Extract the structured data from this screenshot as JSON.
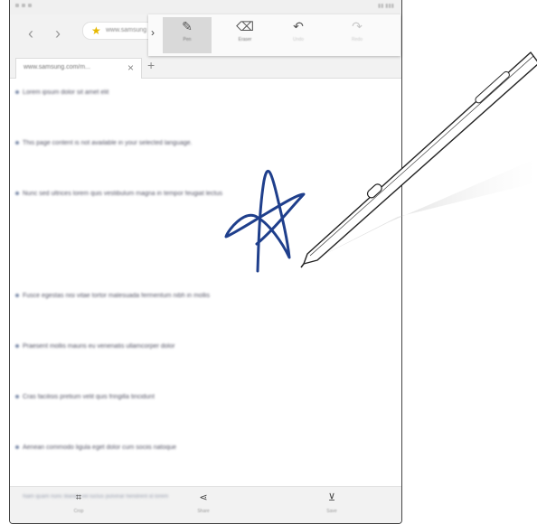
{
  "browser": {
    "url": "www.samsung",
    "tab_title": "www.samsung.com/m...",
    "tab_close": "×",
    "new_tab": "+",
    "back": "‹",
    "forward": "›"
  },
  "toolbar": {
    "expand": "›",
    "tools": [
      {
        "label": "Pen",
        "icon": "pen-icon"
      },
      {
        "label": "Eraser",
        "icon": "eraser-icon"
      },
      {
        "label": "Undo",
        "icon": "undo-icon"
      },
      {
        "label": "Redo",
        "icon": "redo-icon"
      }
    ]
  },
  "content_lines": [
    "Lorem ipsum dolor sit amet elit",
    "This page content is not available in your selected language.",
    "Nunc sed ultrices lorem quis vestibulum magna in tempor feugiat lectus",
    "Fusce egestas nisi vitae tortor malesuada fermentum nibh in mollis",
    "Praesent mollis mauris eu venenatis ullamcorper dolor",
    "Cras facilisis pretium velit quis fringilla tincidunt",
    "Aenean commodo ligula eget dolor cum sociis natoque"
  ],
  "bottom_bar": {
    "ghost_text": "Nam quam nunc blandit vel luctus pulvinar hendrerit id lorem",
    "crop_label": "Crop",
    "share_label": "Share",
    "save_label": "Save"
  },
  "colors": {
    "ink": "#1f3f8c",
    "accent": "#4a73c9",
    "star": "#e6b800"
  }
}
